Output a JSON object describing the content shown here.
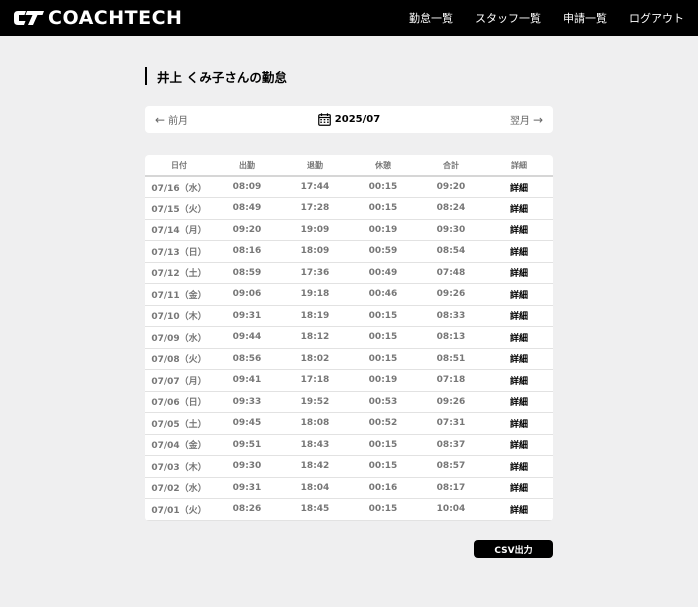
{
  "header": {
    "logo_text": "COACHTECH",
    "nav": [
      "勤怠一覧",
      "スタッフ一覧",
      "申請一覧",
      "ログアウト"
    ]
  },
  "title": "井上 くみ子さんの勤怠",
  "month_nav": {
    "prev_arrow": "←",
    "prev_label": "前月",
    "current": "2025/07",
    "next_label": "翌月",
    "next_arrow": "→"
  },
  "table": {
    "headers": [
      "日付",
      "出勤",
      "退勤",
      "休憩",
      "合計",
      "詳細"
    ],
    "rows": [
      [
        "07/16（水）",
        "08:09",
        "17:44",
        "00:15",
        "09:20",
        "詳細"
      ],
      [
        "07/15（火）",
        "08:49",
        "17:28",
        "00:15",
        "08:24",
        "詳細"
      ],
      [
        "07/14（月）",
        "09:20",
        "19:09",
        "00:19",
        "09:30",
        "詳細"
      ],
      [
        "07/13（日）",
        "08:16",
        "18:09",
        "00:59",
        "08:54",
        "詳細"
      ],
      [
        "07/12（土）",
        "08:59",
        "17:36",
        "00:49",
        "07:48",
        "詳細"
      ],
      [
        "07/11（金）",
        "09:06",
        "19:18",
        "00:46",
        "09:26",
        "詳細"
      ],
      [
        "07/10（木）",
        "09:31",
        "18:19",
        "00:15",
        "08:33",
        "詳細"
      ],
      [
        "07/09（水）",
        "09:44",
        "18:12",
        "00:15",
        "08:13",
        "詳細"
      ],
      [
        "07/08（火）",
        "08:56",
        "18:02",
        "00:15",
        "08:51",
        "詳細"
      ],
      [
        "07/07（月）",
        "09:41",
        "17:18",
        "00:19",
        "07:18",
        "詳細"
      ],
      [
        "07/06（日）",
        "09:33",
        "19:52",
        "00:53",
        "09:26",
        "詳細"
      ],
      [
        "07/05（土）",
        "09:45",
        "18:08",
        "00:52",
        "07:31",
        "詳細"
      ],
      [
        "07/04（金）",
        "09:51",
        "18:43",
        "00:15",
        "08:37",
        "詳細"
      ],
      [
        "07/03（木）",
        "09:30",
        "18:42",
        "00:15",
        "08:57",
        "詳細"
      ],
      [
        "07/02（水）",
        "09:31",
        "18:04",
        "00:16",
        "08:17",
        "詳細"
      ],
      [
        "07/01（火）",
        "08:26",
        "18:45",
        "00:15",
        "10:04",
        "詳細"
      ]
    ]
  },
  "csv_button": "CSV出力"
}
